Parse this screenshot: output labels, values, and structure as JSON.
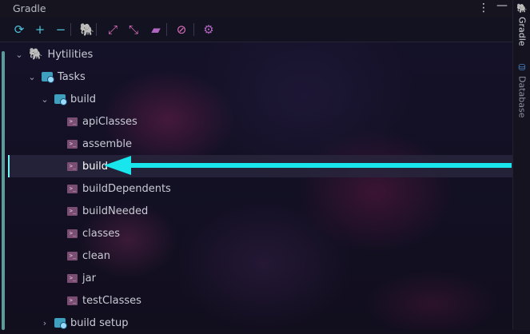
{
  "window": {
    "title": "Gradle"
  },
  "titlebar_icons": [
    "more-vert-icon",
    "minimize-icon"
  ],
  "toolbar": {
    "tools": [
      {
        "name": "refresh-icon",
        "glyph": "⟳",
        "color": "#4fc3d9"
      },
      {
        "name": "add-icon",
        "glyph": "+",
        "color": "#4fc3d9"
      },
      {
        "name": "remove-icon",
        "glyph": "−",
        "color": "#4fc3d9"
      },
      {
        "name": "gradle-elephant-icon",
        "glyph": "🐘",
        "color": "#4fc3d9"
      },
      {
        "name": "expand-all-icon",
        "glyph": "⤢",
        "color": "#e070c0"
      },
      {
        "name": "collapse-all-icon",
        "glyph": "⤡",
        "color": "#e070c0"
      },
      {
        "name": "folder-icon",
        "glyph": "▰",
        "color": "#b066c0"
      },
      {
        "name": "offline-mode-icon",
        "glyph": "⊘",
        "color": "#e070c0"
      },
      {
        "name": "settings-icon",
        "glyph": "⚙",
        "color": "#b066c0"
      }
    ]
  },
  "right_tabs": [
    {
      "label": "Gradle",
      "icon": "gradle-elephant-icon"
    },
    {
      "label": "Database",
      "icon": "database-icon"
    }
  ],
  "tree": [
    {
      "label": "Hytilities",
      "level": 0,
      "kind": "project",
      "expanded": true
    },
    {
      "label": "Tasks",
      "level": 1,
      "kind": "folder",
      "expanded": true
    },
    {
      "label": "build",
      "level": 2,
      "kind": "folder",
      "expanded": true
    },
    {
      "label": "apiClasses",
      "level": 3,
      "kind": "task"
    },
    {
      "label": "assemble",
      "level": 3,
      "kind": "task"
    },
    {
      "label": "build",
      "level": 3,
      "kind": "task",
      "selected": true
    },
    {
      "label": "buildDependents",
      "level": 3,
      "kind": "task"
    },
    {
      "label": "buildNeeded",
      "level": 3,
      "kind": "task"
    },
    {
      "label": "classes",
      "level": 3,
      "kind": "task"
    },
    {
      "label": "clean",
      "level": 3,
      "kind": "task"
    },
    {
      "label": "jar",
      "level": 3,
      "kind": "task"
    },
    {
      "label": "testClasses",
      "level": 3,
      "kind": "task"
    },
    {
      "label": "build setup",
      "level": 2,
      "kind": "folder",
      "expanded": false
    }
  ],
  "colors": {
    "accent_arrow": "#18e5ec",
    "task_icon": "#7a4d73",
    "folder_icon": "#3f9fbf",
    "project_icon": "#3fa65b"
  }
}
